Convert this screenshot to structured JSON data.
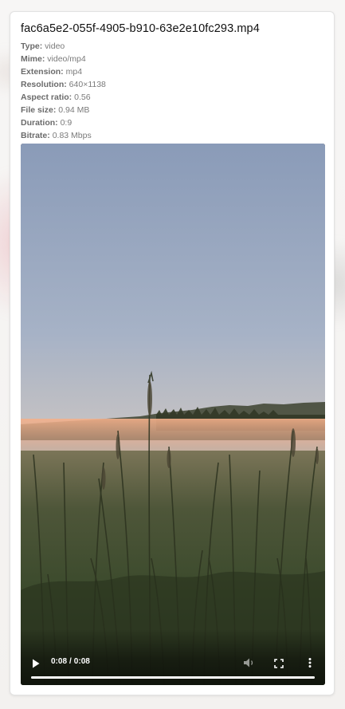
{
  "file": {
    "name": "fac6a5e2-055f-4905-b910-63e2e10fc293.mp4"
  },
  "metadata": [
    {
      "key": "Type:",
      "value": "video"
    },
    {
      "key": "Mime:",
      "value": "video/mp4"
    },
    {
      "key": "Extension:",
      "value": "mp4"
    },
    {
      "key": "Resolution:",
      "value": "640×1138"
    },
    {
      "key": "Aspect ratio:",
      "value": "0.56"
    },
    {
      "key": "File size:",
      "value": "0.94 MB"
    },
    {
      "key": "Duration:",
      "value": "0:9"
    },
    {
      "key": "Bitrate:",
      "value": "0.83 Mbps"
    }
  ],
  "player": {
    "current_time": "0:08",
    "separator": "/",
    "total_time": "0:08",
    "progress": 1.0,
    "icons": {
      "play": "play-icon",
      "volume": "volume-icon",
      "fullscreen": "fullscreen-icon",
      "more": "more-vertical-icon"
    }
  },
  "colors": {
    "sky_top": "#8a9bb8",
    "horizon": "#f2b78e",
    "ground": "#3b4a2c"
  }
}
